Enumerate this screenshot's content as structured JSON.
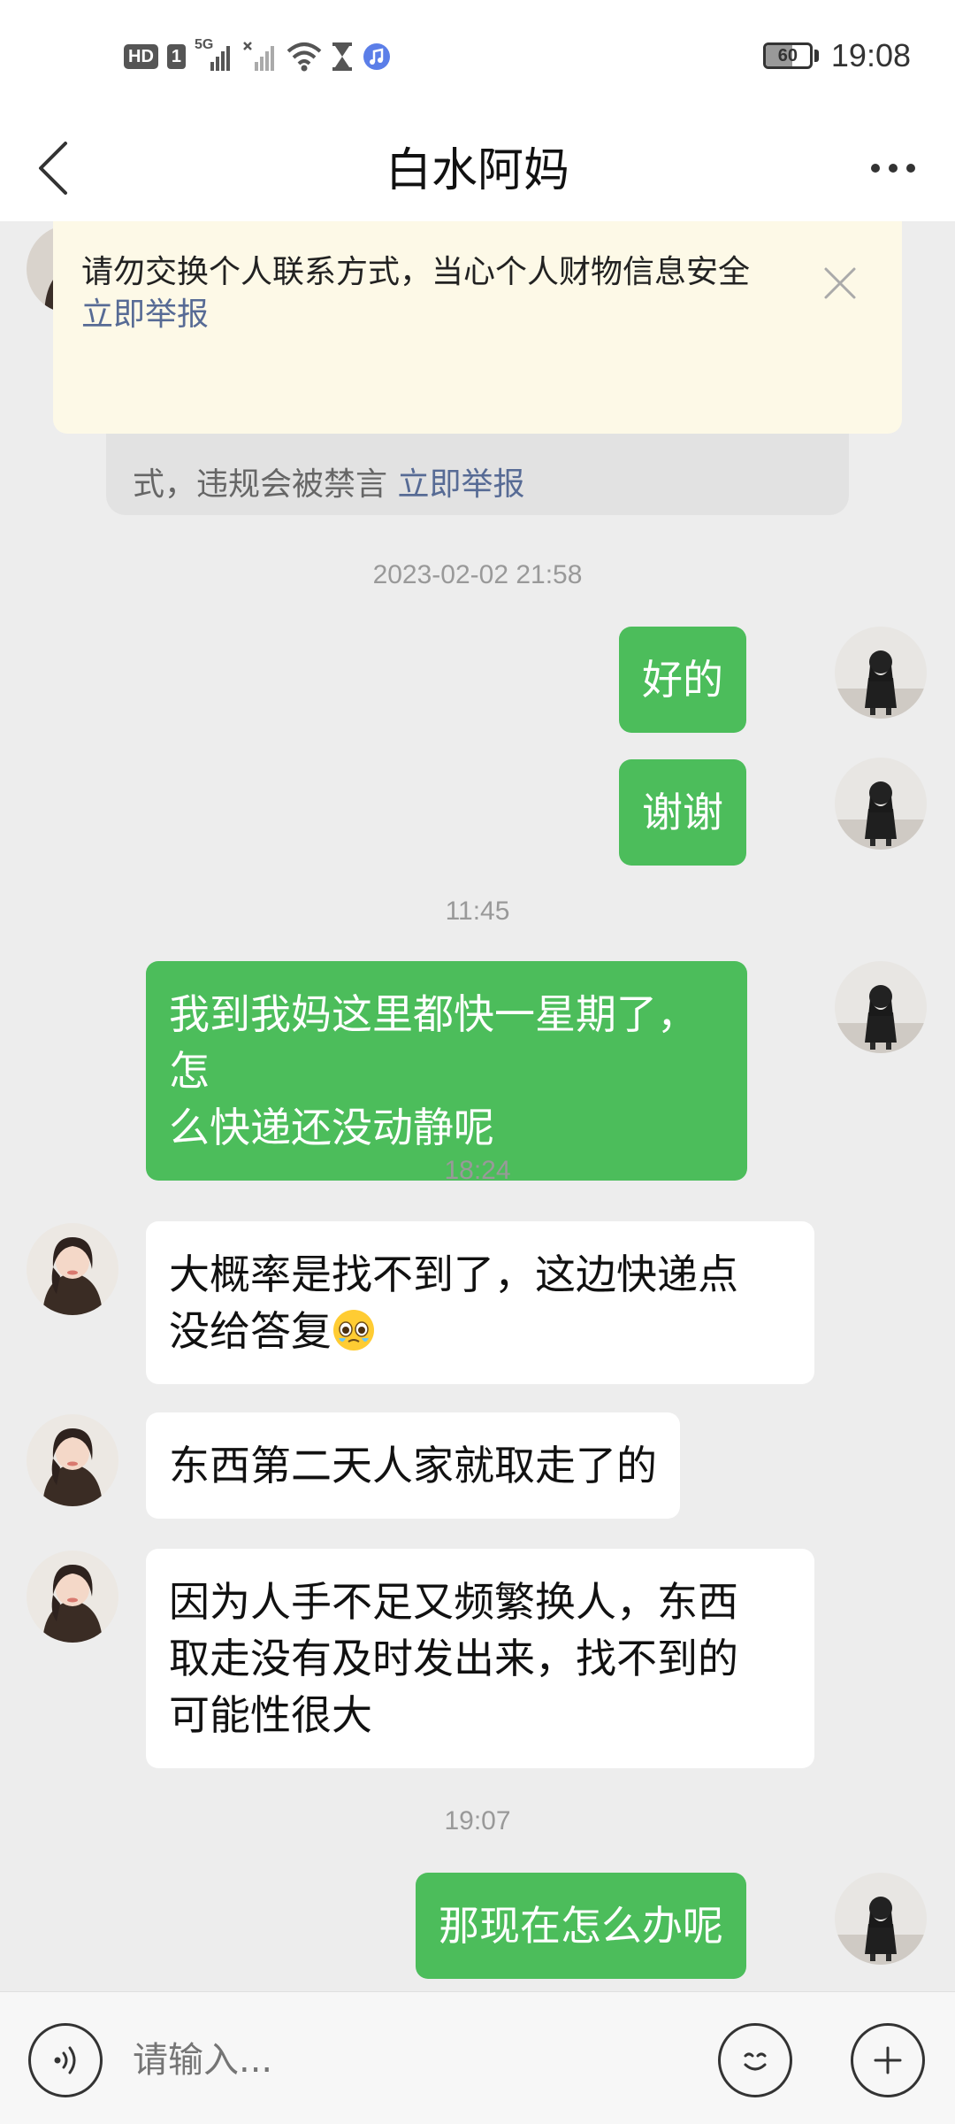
{
  "status_bar": {
    "hd_badge": "HD",
    "sim_badge": "1",
    "network": "5G",
    "icons": [
      "signal-strength-icon",
      "no-signal-icon",
      "wifi-icon",
      "hourglass-icon",
      "music-app-icon"
    ],
    "battery": "60",
    "battery_level": 0.6,
    "time": "19:08"
  },
  "header": {
    "title": "白水阿妈",
    "back_icon": "chevron-left-icon",
    "more_icon": "more-dots-icon"
  },
  "warning_banner": {
    "text": "请勿交换个人联系方式，当心个人财物信息安全",
    "link": "立即举报",
    "close_icon": "close-icon"
  },
  "system_notice": {
    "text": "式，违规会被禁言",
    "link": "立即举报"
  },
  "messages": [
    {
      "type": "time",
      "text": "2023-02-02 21:58"
    },
    {
      "from": "me",
      "lines": [
        "好的"
      ]
    },
    {
      "from": "me",
      "lines": [
        "谢谢"
      ]
    },
    {
      "type": "time",
      "text": "11:45"
    },
    {
      "from": "me",
      "lines": [
        "我到我妈这里都快一星期了，怎",
        "么快递还没动静呢"
      ]
    },
    {
      "type": "time",
      "text": "18:24"
    },
    {
      "from": "them",
      "lines": [
        "大概率是找不到了，这边快递点",
        "没给答复"
      ],
      "emoji": "pleading-face-emoji"
    },
    {
      "from": "them",
      "lines": [
        "东西第二天人家就取走了的"
      ]
    },
    {
      "from": "them",
      "lines": [
        "因为人手不足又频繁换人，东西",
        "取走没有及时发出来，找不到的",
        "可能性很大"
      ]
    },
    {
      "type": "time",
      "text": "19:07"
    },
    {
      "from": "me",
      "lines": [
        "那现在怎么办呢"
      ]
    }
  ],
  "input_bar": {
    "placeholder": "请输入...",
    "voice_icon": "voice-input-icon",
    "emoji_icon": "emoji-icon",
    "plus_icon": "plus-icon"
  },
  "colors": {
    "sent_bubble": "#4cbd5b",
    "received_bubble": "#ffffff",
    "background": "#ededed",
    "link": "#576b95",
    "banner": "#fdf9e7"
  }
}
